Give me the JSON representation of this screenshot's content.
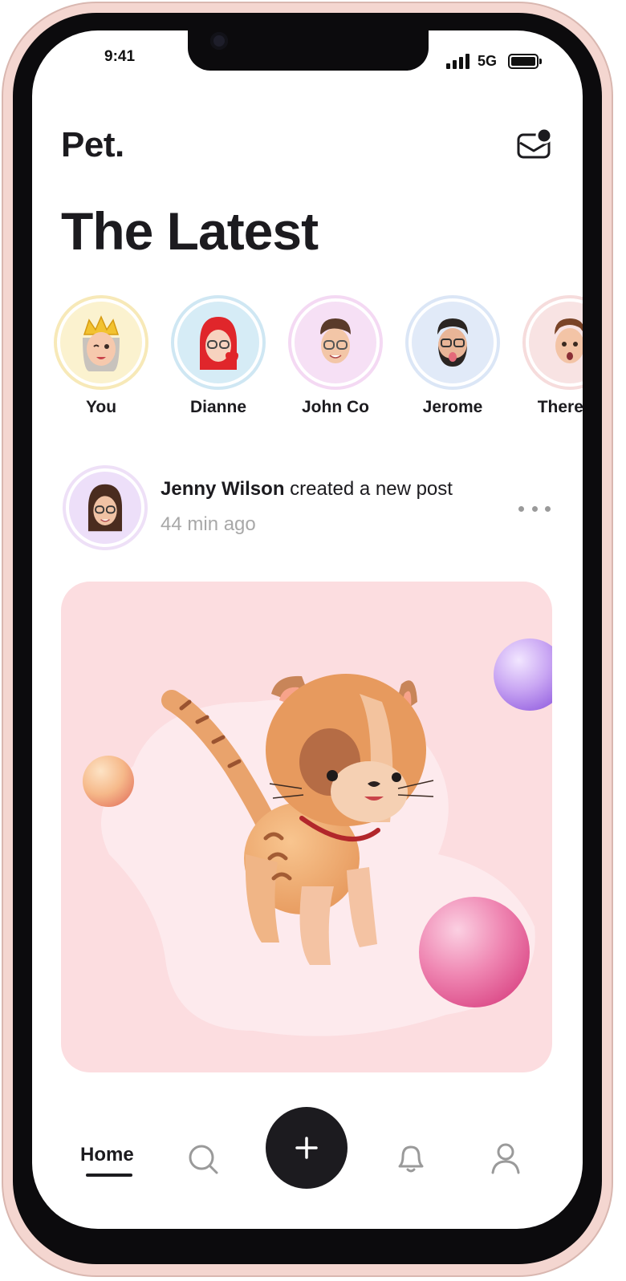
{
  "status_bar": {
    "time": "9:41",
    "network": "5G"
  },
  "header": {
    "brand": "Pet.",
    "mail_icon": "mail-notification-icon"
  },
  "page_title": "The Latest",
  "stories": [
    {
      "label": "You",
      "ring": "#f7e9b8",
      "bg": "#fbf2cf",
      "avatar": "memoji-crown-girl"
    },
    {
      "label": "Dianne",
      "ring": "#cfe7f3",
      "bg": "#d6ecf6",
      "avatar": "memoji-red-hair"
    },
    {
      "label": "John Co",
      "ring": "#f4d9f3",
      "bg": "#f6e0f5",
      "avatar": "memoji-glasses-boy"
    },
    {
      "label": "Jerome",
      "ring": "#dbe6f6",
      "bg": "#e1eaf8",
      "avatar": "memoji-beard"
    },
    {
      "label": "Theresa",
      "ring": "#f6dcdc",
      "bg": "#f8e3e3",
      "avatar": "memoji-surprised"
    }
  ],
  "post": {
    "author": "Jenny Wilson",
    "action": " created a new post",
    "time": "44 min ago",
    "image": "3d-orange-kitten"
  },
  "nav": {
    "home": "Home",
    "icons": [
      "search-icon",
      "plus-icon",
      "bell-icon",
      "profile-icon"
    ]
  }
}
